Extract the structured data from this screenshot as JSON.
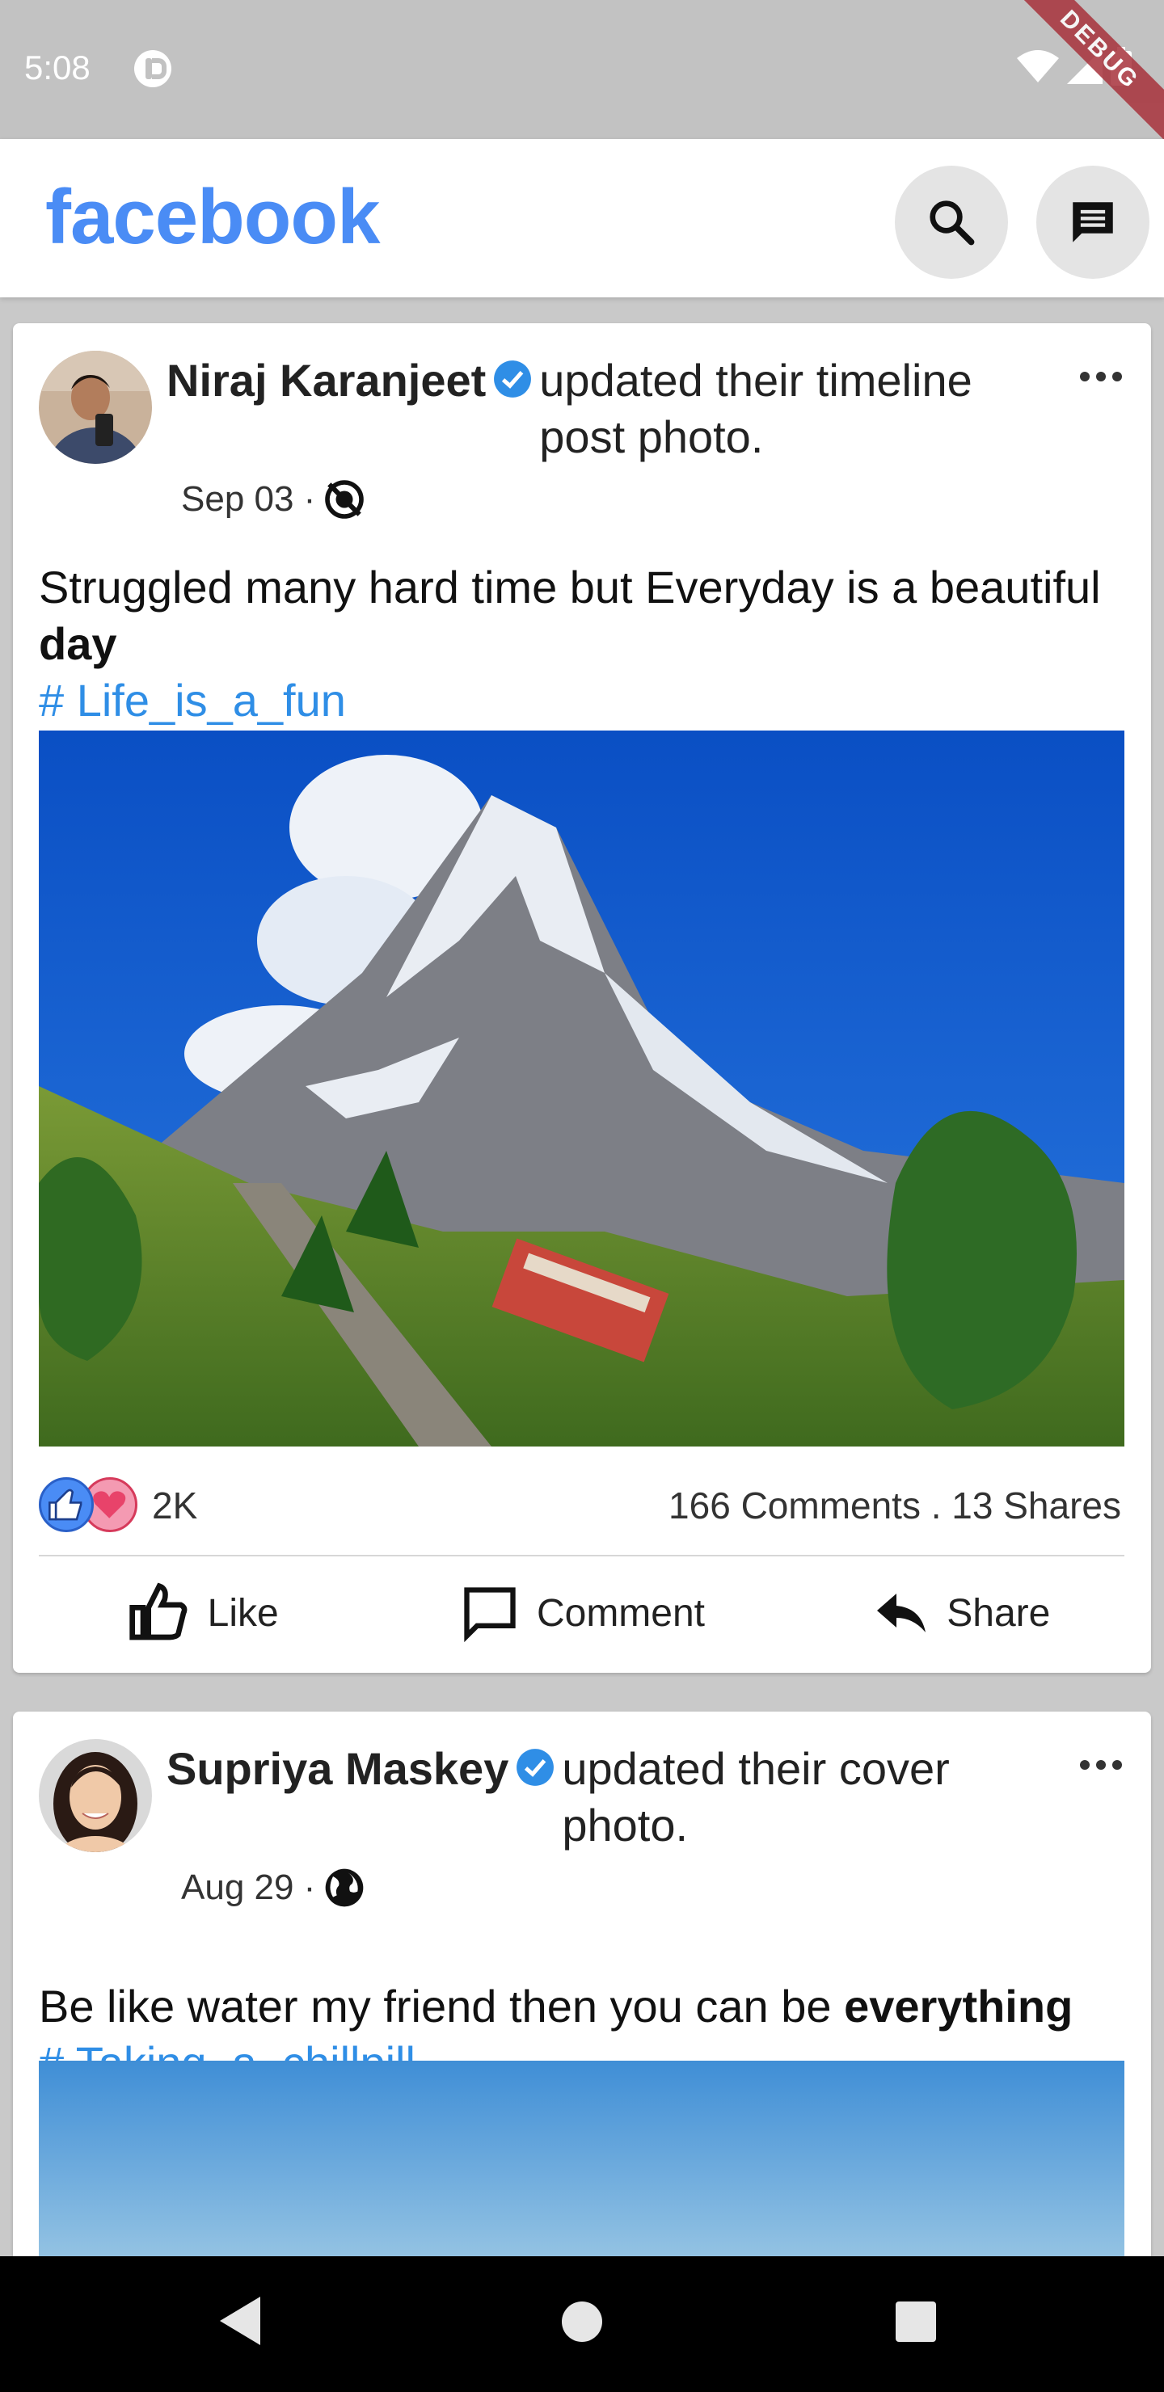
{
  "status_bar": {
    "time": "5:08",
    "debug_label": "DEBUG"
  },
  "app_bar": {
    "brand": "facebook"
  },
  "posts": [
    {
      "author": "Niraj Karanjeet",
      "action": "updated their timeline post photo.",
      "date": "Sep 03 ·",
      "privacy": "private",
      "text_prefix": "Struggled many hard time but Everyday is a beautiful ",
      "text_bold": "day",
      "hashtag": "# Life_is_a_fun",
      "reaction_count": "2K",
      "counts": "166 Comments . 13 Shares",
      "actions": {
        "like": "Like",
        "comment": "Comment",
        "share": "Share"
      }
    },
    {
      "author": "Supriya Maskey",
      "action": "updated their cover photo.",
      "date": "Aug 29 ·",
      "privacy": "public",
      "text_prefix": "Be like water my friend then you can be ",
      "text_bold": "everything",
      "hashtag": "# Taking_a_chillpill"
    }
  ],
  "colors": {
    "brand": "#4a8cf5",
    "hashtag": "#2f8ee6",
    "verified": "#2f8ee6"
  }
}
